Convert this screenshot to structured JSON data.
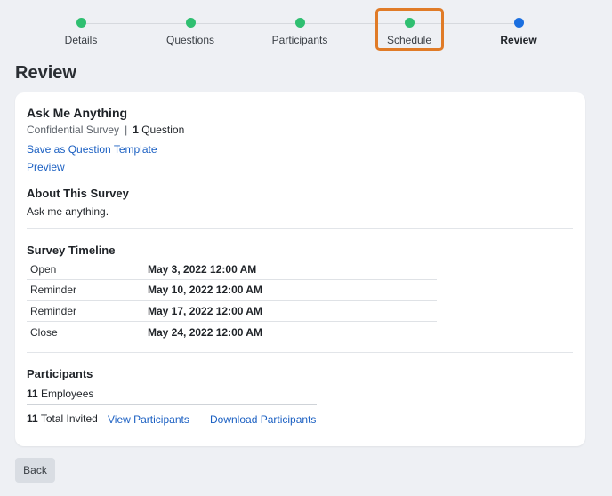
{
  "stepper": {
    "steps": [
      {
        "label": "Details",
        "status": "complete",
        "color": "#2fbf71"
      },
      {
        "label": "Questions",
        "status": "complete",
        "color": "#2fbf71"
      },
      {
        "label": "Participants",
        "status": "complete",
        "color": "#2fbf71"
      },
      {
        "label": "Schedule",
        "status": "complete",
        "color": "#2fbf71",
        "highlighted": true
      },
      {
        "label": "Review",
        "status": "current",
        "color": "#1a6fe0"
      }
    ]
  },
  "page_title": "Review",
  "survey": {
    "title": "Ask Me Anything",
    "type": "Confidential Survey",
    "separator": "|",
    "question_count": "1",
    "question_label": "Question",
    "save_template_label": "Save as Question Template",
    "preview_label": "Preview"
  },
  "about": {
    "title": "About This Survey",
    "text": "Ask me anything."
  },
  "timeline": {
    "title": "Survey Timeline",
    "rows": [
      {
        "label": "Open",
        "value": "May 3, 2022 12:00 AM"
      },
      {
        "label": "Reminder",
        "value": "May 10, 2022 12:00 AM"
      },
      {
        "label": "Reminder",
        "value": "May 17, 2022 12:00 AM"
      },
      {
        "label": "Close",
        "value": "May 24, 2022 12:00 AM"
      }
    ]
  },
  "participants": {
    "title": "Participants",
    "employees_count": "11",
    "employees_label": "Employees",
    "invited_count": "11",
    "invited_label": "Total Invited",
    "view_label": "View Participants",
    "download_label": "Download Participants"
  },
  "back_label": "Back"
}
